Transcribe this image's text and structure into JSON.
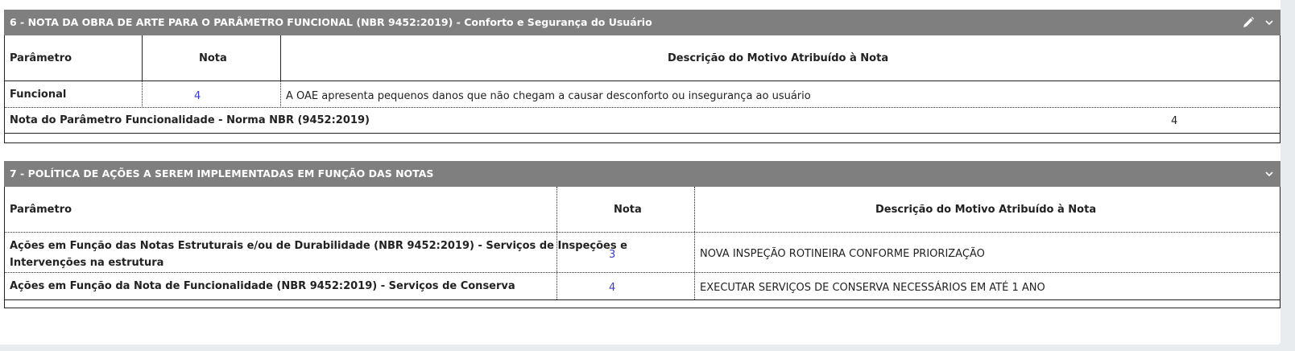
{
  "section6": {
    "title": "6 - NOTA DA OBRA DE ARTE PARA O PARÂMETRO FUNCIONAL (NBR 9452:2019) - Conforto e Segurança do Usuário",
    "col_parametro": "Parâmetro",
    "col_nota": "Nota",
    "col_descricao": "Descrição do Motivo Atribuído à Nota",
    "row": {
      "parametro": "Funcional",
      "nota": "4",
      "descricao": "A OAE apresenta pequenos danos que não chegam a causar desconforto ou insegurança ao usuário"
    },
    "summary_label": "Nota do Parâmetro Funcionalidade - Norma NBR (9452:2019)",
    "summary_value": "4"
  },
  "section7": {
    "title": "7 - POLÍTICA DE AÇÕES A SEREM IMPLEMENTADAS EM FUNÇÃO DAS NOTAS",
    "col_parametro": "Parâmetro",
    "col_nota": "Nota",
    "col_descricao": "Descrição do Motivo Atribuído à Nota",
    "rows": [
      {
        "parametro_line1": "Ações em Função das Notas Estruturais e/ou de Durabilidade (NBR 9452:2019) - Serviços de Inspeções e",
        "parametro_line2": "Intervenções na estrutura",
        "nota": "3",
        "descricao": "NOVA INSPEÇÃO ROTINEIRA CONFORME PRIORIZAÇÃO"
      },
      {
        "parametro_line1": "Ações em Função da Nota de Funcionalidade (NBR 9452:2019) - Serviços de Conserva",
        "nota": "4",
        "descricao": "EXECUTAR SERVIÇOS DE CONSERVA NECESSÁRIOS EM ATÉ 1 ANO"
      }
    ]
  },
  "icons": {
    "edit": "pencil-icon",
    "collapse": "chevron-down-icon"
  }
}
